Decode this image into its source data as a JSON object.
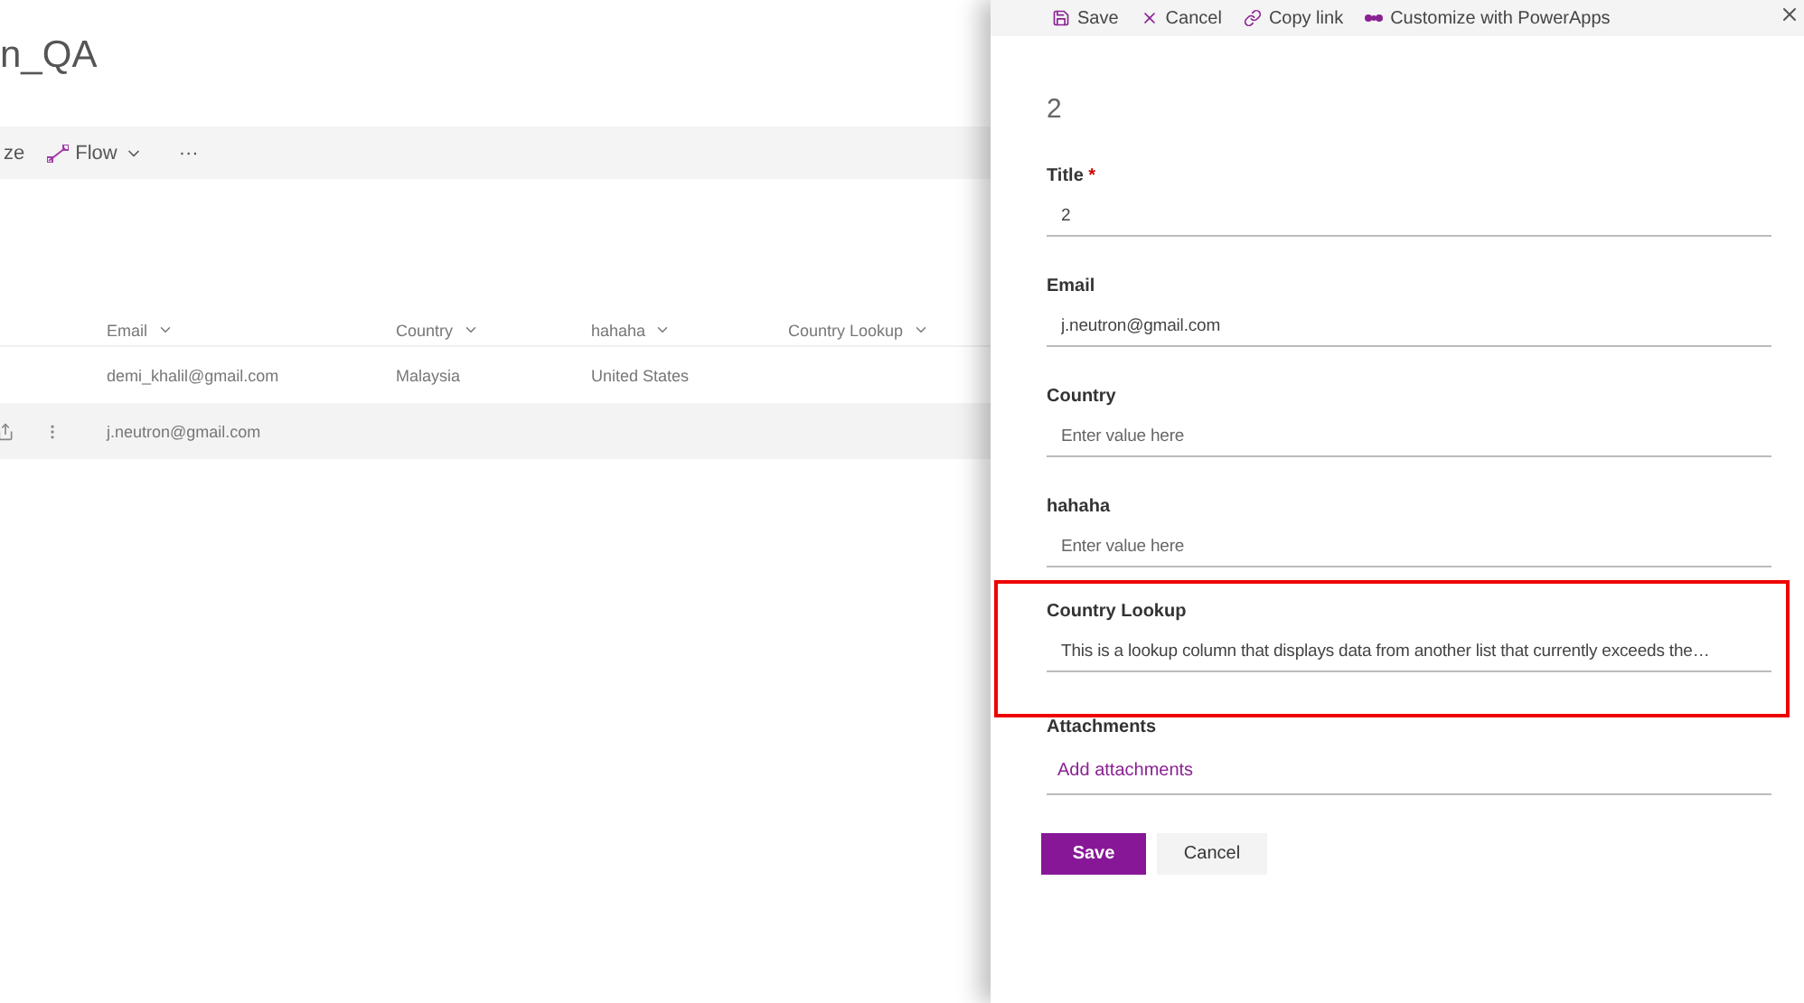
{
  "page": {
    "title": "n_QA",
    "toolbar": [
      {
        "kind": "text",
        "label": "ze"
      },
      {
        "kind": "flow",
        "label": "Flow"
      },
      {
        "kind": "more",
        "label": "···"
      }
    ],
    "table": {
      "columns": [
        "Email",
        "Country",
        "hahaha",
        "Country Lookup"
      ],
      "rows": [
        {
          "selected": false,
          "cells": [
            "demi_khalil@gmail.com",
            "Malaysia",
            "United States",
            ""
          ]
        },
        {
          "selected": true,
          "cells": [
            "j.neutron@gmail.com",
            "",
            "",
            ""
          ]
        }
      ]
    }
  },
  "panel": {
    "toolbar": [
      "Save",
      "Cancel",
      "Copy link",
      "Customize with PowerApps"
    ],
    "heading": "2",
    "required_mark": "*",
    "fields": [
      {
        "kind": "text",
        "label": "Title",
        "required": true,
        "value": "2",
        "highlighted": false
      },
      {
        "kind": "text",
        "label": "Email",
        "required": false,
        "value": "j.neutron@gmail.com",
        "highlighted": false
      },
      {
        "kind": "text",
        "label": "Country",
        "required": false,
        "placeholder": "Enter value here",
        "highlighted": false
      },
      {
        "kind": "text",
        "label": "hahaha",
        "required": false,
        "placeholder": "Enter value here",
        "highlighted": false
      },
      {
        "kind": "text",
        "label": "Country Lookup",
        "required": false,
        "value": "This is a lookup column that displays data from another list that currently exceeds the…",
        "highlighted": true
      },
      {
        "kind": "link",
        "label": "Attachments",
        "required": false,
        "value": "Add attachments",
        "highlighted": false
      }
    ],
    "buttons": [
      "Save",
      "Cancel"
    ]
  }
}
